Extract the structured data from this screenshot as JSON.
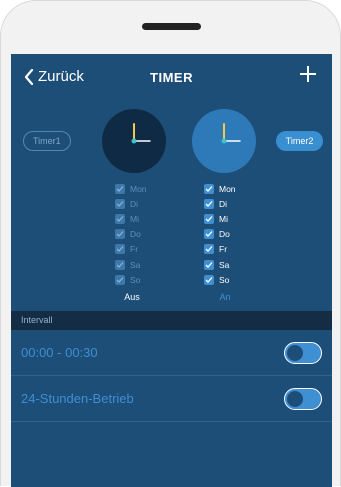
{
  "nav": {
    "back_label": "Zurück",
    "title": "TIMER",
    "add_icon": "plus-icon"
  },
  "timers": [
    {
      "label": "Timer1",
      "selected": false,
      "status": "Aus",
      "days": [
        "Mon",
        "Di",
        "Mi",
        "Do",
        "Fr",
        "Sa",
        "So"
      ]
    },
    {
      "label": "Timer2",
      "selected": true,
      "status": "An",
      "days": [
        "Mon",
        "Di",
        "Mi",
        "Do",
        "Fr",
        "Sa",
        "So"
      ]
    }
  ],
  "interval": {
    "header": "Intervall",
    "rows": [
      {
        "label": "00:00 - 00:30",
        "toggle_on": true
      },
      {
        "label": "24-Stunden-Betrieb",
        "toggle_on": true
      }
    ]
  },
  "colors": {
    "background": "#1d4e78",
    "accent": "#3f8fd3",
    "section_header": "#142d45",
    "hand_hour": "#f2c94c",
    "hand_minute": "#ffffff"
  }
}
